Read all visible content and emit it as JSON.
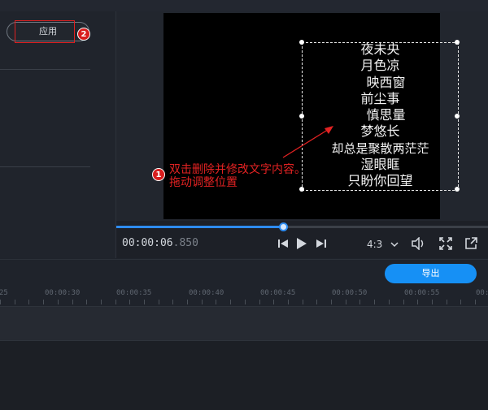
{
  "left_panel": {
    "apply_label": "应用",
    "apply_badge": "2"
  },
  "preview": {
    "poem_lines": [
      "夜未央",
      "月色凉",
      "映西窗",
      "前尘事",
      "慎思量",
      "梦悠长",
      "却总是聚散两茫茫",
      "湿眼眶",
      "只盼你回望"
    ],
    "annotation_badge": "1",
    "annotation_lines": [
      "双击删除并修改文字内容。",
      "拖动调整位置"
    ]
  },
  "player": {
    "timecode_main": "00:00:06",
    "timecode_ms": ".850",
    "progress": 0.45,
    "aspect_ratio": "4:3",
    "icons": [
      "skip-back-icon",
      "play-icon",
      "skip-forward-icon",
      "chevron-down-icon",
      "volume-icon",
      "fullscreen-icon",
      "popout-icon"
    ]
  },
  "export": {
    "label": "导出"
  },
  "timeline": {
    "ticks": [
      "25",
      "00:00:30",
      "00:00:35",
      "00:00:40",
      "00:00:45",
      "00:00:50",
      "00:00:55",
      "00:0"
    ]
  },
  "colors": {
    "accent": "#1690f5",
    "annotation_red": "#e22222"
  }
}
